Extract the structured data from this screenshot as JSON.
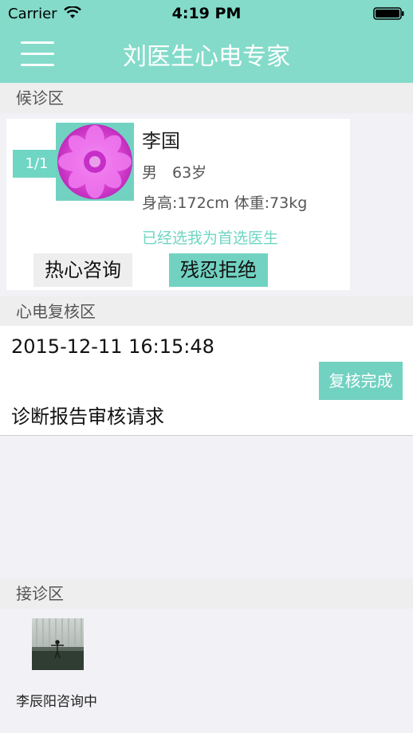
{
  "status_bar": {
    "carrier": "Carrier",
    "time": "4:19 PM"
  },
  "header": {
    "title": "刘医生心电专家",
    "menu_icon": "hamburger-menu-icon",
    "background": "#84dbca"
  },
  "waiting": {
    "section_label": "候诊区",
    "page_indicator": "1/1",
    "patient": {
      "name": "李国",
      "gender_age": "男　63岁",
      "height_weight": "身高:172cm 体重:73kg",
      "preferred_note": "已经选我为首选医生"
    },
    "consult_button": "热心咨询",
    "reject_button": "残忍拒绝"
  },
  "review": {
    "section_label": "心电复核区",
    "datetime": "2015-12-11 16:15:48",
    "request_text": "诊断报告审核请求",
    "done_button": "复核完成"
  },
  "accepted": {
    "section_label": "接诊区",
    "patient_status": "李辰阳咨询中"
  },
  "colors": {
    "accent": "#72d2c2",
    "accent_text": "#6fd6c4",
    "section_bg": "#eeeeee",
    "page_bg": "#f2f2f6"
  }
}
